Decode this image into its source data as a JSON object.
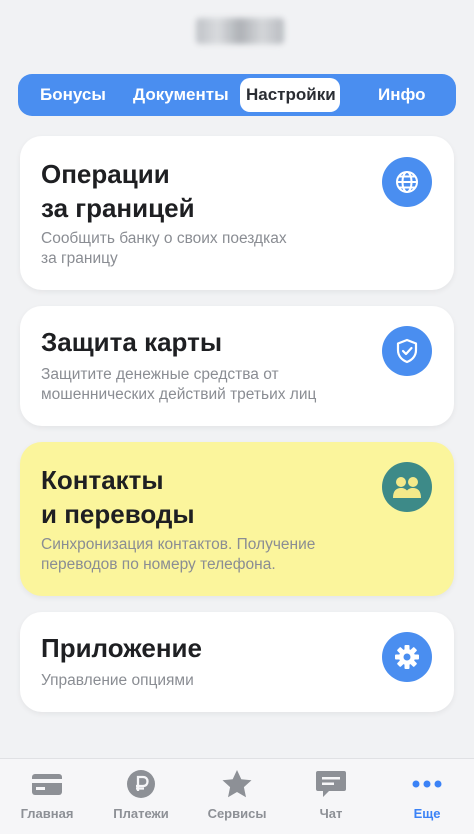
{
  "tabs": [
    {
      "label": "Бонусы"
    },
    {
      "label": "Документы"
    },
    {
      "label": "Настройки"
    },
    {
      "label": "Инфо"
    }
  ],
  "active_tab": "Настройки",
  "cards": [
    {
      "title_line1": "Операции",
      "title_line2": "за границей",
      "desc_line1": "Сообщить банку о своих поездках",
      "desc_line2": "за границу",
      "icon": "globe-icon"
    },
    {
      "title_line1": "Защита карты",
      "desc_line1": "Защитите денежные средства от",
      "desc_line2": "мошеннических действий третьих лиц",
      "icon": "shield-check-icon"
    },
    {
      "title_line1": "Контакты",
      "title_line2": "и переводы",
      "desc_line1": "Синхронизация контактов. Получение",
      "desc_line2": "переводов по номеру телефона.",
      "icon": "contacts-icon"
    },
    {
      "title_line1": "Приложение",
      "desc_line1": "Управление опциями",
      "icon": "gear-icon"
    }
  ],
  "tabbar": [
    {
      "label": "Главная",
      "icon": "card-icon"
    },
    {
      "label": "Платежи",
      "icon": "ruble-icon"
    },
    {
      "label": "Сервисы",
      "icon": "star-icon"
    },
    {
      "label": "Чат",
      "icon": "chat-icon"
    },
    {
      "label": "Еще",
      "icon": "more-dots-icon"
    }
  ],
  "colors": {
    "accent": "#4a8ef0",
    "highlight_card": "#fbf59c",
    "teal": "#3d8a88",
    "active_tabbar": "#3b82f6"
  }
}
